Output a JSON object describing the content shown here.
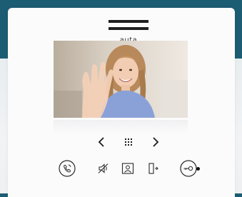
{
  "device": {
    "brand": "auta",
    "accent_color": "#1d5d74"
  },
  "screen": {
    "content": "camera-feed"
  },
  "navigation": {
    "prev_icon": "chevron-left-icon",
    "menu_icon": "grid-menu-icon",
    "next_icon": "chevron-right-icon"
  },
  "controls": [
    {
      "icon": "handset-call-icon"
    },
    {
      "icon": "mute-speaker-icon"
    },
    {
      "icon": "contact-monitor-icon"
    },
    {
      "icon": "door-open-icon"
    },
    {
      "icon": "key-unlock-icon"
    }
  ],
  "status": {
    "indicator_color": "#111111"
  }
}
